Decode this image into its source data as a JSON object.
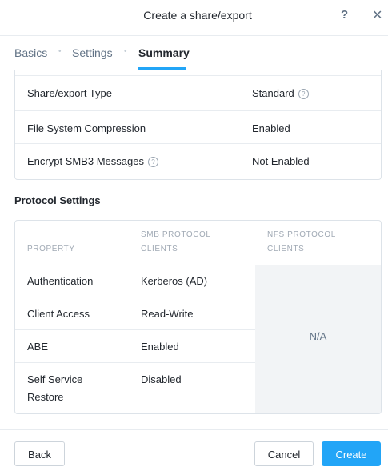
{
  "dialog": {
    "title": "Create a share/export",
    "help_icon": "?",
    "close_icon": "✕"
  },
  "tabs": [
    {
      "label": "Basics",
      "active": false
    },
    {
      "label": "Settings",
      "active": false
    },
    {
      "label": "Summary",
      "active": true
    }
  ],
  "summary": {
    "rows": [
      {
        "key": "Share/export Type",
        "value": "Standard",
        "help": "value"
      },
      {
        "key": "File System Compression",
        "value": "Enabled"
      },
      {
        "key": "Encrypt SMB3 Messages",
        "value": "Not Enabled",
        "help": "key"
      }
    ]
  },
  "protocol_settings": {
    "title": "Protocol Settings",
    "headers": {
      "property": "PROPERTY",
      "smb_line1": "SMB PROTOCOL",
      "smb_line2": "CLIENTS",
      "nfs_line1": "NFS PROTOCOL",
      "nfs_line2": "CLIENTS"
    },
    "rows": [
      {
        "property": "Authentication",
        "smb": "Kerberos (AD)"
      },
      {
        "property": "Client Access",
        "smb": "Read-Write"
      },
      {
        "property": "ABE",
        "smb": "Enabled"
      },
      {
        "property_line1": "Self Service",
        "property_line2": "Restore",
        "smb": "Disabled"
      }
    ],
    "nfs_value": "N/A"
  },
  "footer": {
    "back": "Back",
    "cancel": "Cancel",
    "create": "Create"
  },
  "colors": {
    "accent": "#22a5f7",
    "muted": "#627386",
    "border": "#dde3e9"
  }
}
